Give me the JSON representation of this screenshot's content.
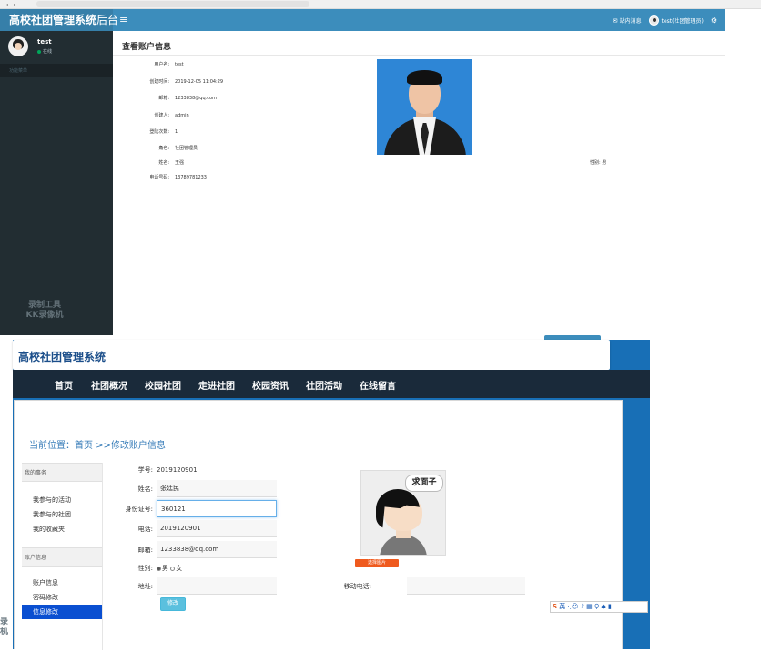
{
  "admin": {
    "brand_bold": "高校社团管理系统",
    "brand_light": "后台",
    "menu_icon": "bars-icon",
    "mail_label": "站内消息",
    "account_label": "test(社团管理员)",
    "user": {
      "name": "test",
      "status": "在线"
    },
    "sidebar_header": "功能菜单",
    "watermark_line1": "录制工具",
    "watermark_line2": "KK录像机",
    "page_title": "查看账户信息",
    "fields": [
      {
        "label": "用户名:",
        "value": "test"
      },
      {
        "label": "创建时间:",
        "value": "2019-12-05 11:04:29"
      },
      {
        "label": "邮箱:",
        "value": "1233838@qq.com"
      },
      {
        "label": "创建人:",
        "value": "admin"
      },
      {
        "label": "登陆次数:",
        "value": "1"
      },
      {
        "label": "角色:",
        "value": "社团管理员"
      },
      {
        "label": "姓名:",
        "value": "王强"
      },
      {
        "label": "电话号码:",
        "value": "13789781233"
      }
    ],
    "gender_label": "性别:",
    "gender_value": "男"
  },
  "front": {
    "site_title": "高校社团管理系统",
    "nav": [
      "首页",
      "社团概况",
      "校园社团",
      "走进社团",
      "校园资讯",
      "社团活动",
      "在线留言"
    ],
    "breadcrumb": "当前位置：首页 >>修改账户信息",
    "menu_groups": [
      {
        "title": "我的事务",
        "items": [
          "我参与的活动",
          "我参与的社团",
          "我的收藏夹"
        ]
      },
      {
        "title": "账户信息",
        "items": [
          "账户信息",
          "密码修改",
          "信息修改"
        ]
      }
    ],
    "active_item": "信息修改",
    "form": {
      "student_id_label": "学号:",
      "student_id_value": "2019120901",
      "name_label": "姓名:",
      "name_value": "张廷民",
      "id_card_label": "身份证号:",
      "id_card_value": "360121",
      "phone_label": "电话:",
      "phone_value": "2019120901",
      "email_label": "邮箱:",
      "email_value": "1233838@qq.com",
      "gender_label": "性别:",
      "gender_male": "男",
      "gender_female": "女",
      "address_label": "地址:",
      "address_value": "",
      "mobile_label": "移动电话:",
      "mobile_value": "",
      "submit_label": "修改"
    },
    "avatar_bubble": "求面子",
    "upload_label": "选择图片",
    "ime_label": "英"
  },
  "colors": {
    "admin_header": "#3c8dbc",
    "admin_sidebar": "#222d32",
    "front_bg": "#186fb6",
    "front_nav": "#1a2a3a",
    "active_menu": "#0a4fd1"
  }
}
